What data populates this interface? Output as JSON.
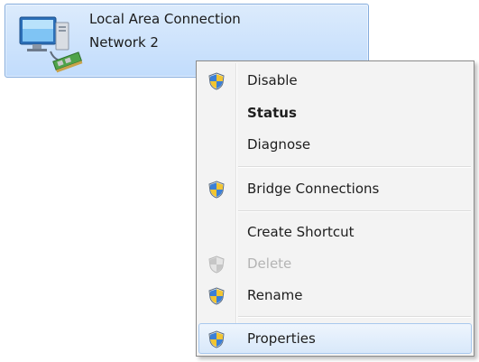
{
  "connection": {
    "name": "Local Area Connection",
    "network": "Network 2",
    "icon": "network-adapter-icon"
  },
  "context_menu": {
    "items": [
      {
        "label": "Disable",
        "icon": "uac-shield-icon",
        "bold": false,
        "enabled": true
      },
      {
        "label": "Status",
        "icon": null,
        "bold": true,
        "enabled": true
      },
      {
        "label": "Diagnose",
        "icon": null,
        "bold": false,
        "enabled": true
      },
      {
        "label": "Bridge Connections",
        "icon": "uac-shield-icon",
        "bold": false,
        "enabled": true
      },
      {
        "label": "Create Shortcut",
        "icon": null,
        "bold": false,
        "enabled": true
      },
      {
        "label": "Delete",
        "icon": "uac-shield-icon",
        "bold": false,
        "enabled": false
      },
      {
        "label": "Rename",
        "icon": "uac-shield-icon",
        "bold": false,
        "enabled": true
      },
      {
        "label": "Properties",
        "icon": "uac-shield-icon",
        "bold": false,
        "enabled": true,
        "highlighted": true
      }
    ]
  },
  "colors": {
    "selection_fill": "#c8e0fc",
    "selection_border": "#84acdd",
    "menu_background": "#f3f3f3",
    "hover_border": "#a8c8ee",
    "disabled_text": "#b4b4b4"
  }
}
